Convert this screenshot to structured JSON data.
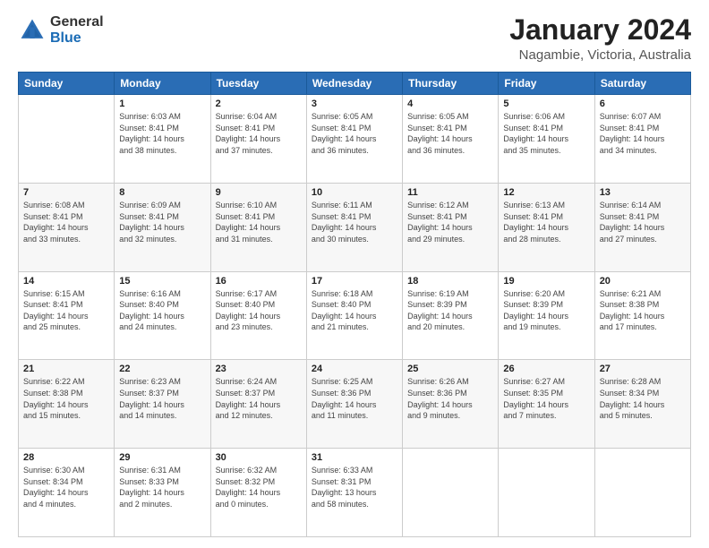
{
  "header": {
    "logo": {
      "general": "General",
      "blue": "Blue"
    },
    "title": "January 2024",
    "subtitle": "Nagambie, Victoria, Australia"
  },
  "calendar": {
    "days_of_week": [
      "Sunday",
      "Monday",
      "Tuesday",
      "Wednesday",
      "Thursday",
      "Friday",
      "Saturday"
    ],
    "weeks": [
      [
        {
          "day": "",
          "info": ""
        },
        {
          "day": "1",
          "info": "Sunrise: 6:03 AM\nSunset: 8:41 PM\nDaylight: 14 hours\nand 38 minutes."
        },
        {
          "day": "2",
          "info": "Sunrise: 6:04 AM\nSunset: 8:41 PM\nDaylight: 14 hours\nand 37 minutes."
        },
        {
          "day": "3",
          "info": "Sunrise: 6:05 AM\nSunset: 8:41 PM\nDaylight: 14 hours\nand 36 minutes."
        },
        {
          "day": "4",
          "info": "Sunrise: 6:05 AM\nSunset: 8:41 PM\nDaylight: 14 hours\nand 36 minutes."
        },
        {
          "day": "5",
          "info": "Sunrise: 6:06 AM\nSunset: 8:41 PM\nDaylight: 14 hours\nand 35 minutes."
        },
        {
          "day": "6",
          "info": "Sunrise: 6:07 AM\nSunset: 8:41 PM\nDaylight: 14 hours\nand 34 minutes."
        }
      ],
      [
        {
          "day": "7",
          "info": "Sunrise: 6:08 AM\nSunset: 8:41 PM\nDaylight: 14 hours\nand 33 minutes."
        },
        {
          "day": "8",
          "info": "Sunrise: 6:09 AM\nSunset: 8:41 PM\nDaylight: 14 hours\nand 32 minutes."
        },
        {
          "day": "9",
          "info": "Sunrise: 6:10 AM\nSunset: 8:41 PM\nDaylight: 14 hours\nand 31 minutes."
        },
        {
          "day": "10",
          "info": "Sunrise: 6:11 AM\nSunset: 8:41 PM\nDaylight: 14 hours\nand 30 minutes."
        },
        {
          "day": "11",
          "info": "Sunrise: 6:12 AM\nSunset: 8:41 PM\nDaylight: 14 hours\nand 29 minutes."
        },
        {
          "day": "12",
          "info": "Sunrise: 6:13 AM\nSunset: 8:41 PM\nDaylight: 14 hours\nand 28 minutes."
        },
        {
          "day": "13",
          "info": "Sunrise: 6:14 AM\nSunset: 8:41 PM\nDaylight: 14 hours\nand 27 minutes."
        }
      ],
      [
        {
          "day": "14",
          "info": "Sunrise: 6:15 AM\nSunset: 8:41 PM\nDaylight: 14 hours\nand 25 minutes."
        },
        {
          "day": "15",
          "info": "Sunrise: 6:16 AM\nSunset: 8:40 PM\nDaylight: 14 hours\nand 24 minutes."
        },
        {
          "day": "16",
          "info": "Sunrise: 6:17 AM\nSunset: 8:40 PM\nDaylight: 14 hours\nand 23 minutes."
        },
        {
          "day": "17",
          "info": "Sunrise: 6:18 AM\nSunset: 8:40 PM\nDaylight: 14 hours\nand 21 minutes."
        },
        {
          "day": "18",
          "info": "Sunrise: 6:19 AM\nSunset: 8:39 PM\nDaylight: 14 hours\nand 20 minutes."
        },
        {
          "day": "19",
          "info": "Sunrise: 6:20 AM\nSunset: 8:39 PM\nDaylight: 14 hours\nand 19 minutes."
        },
        {
          "day": "20",
          "info": "Sunrise: 6:21 AM\nSunset: 8:38 PM\nDaylight: 14 hours\nand 17 minutes."
        }
      ],
      [
        {
          "day": "21",
          "info": "Sunrise: 6:22 AM\nSunset: 8:38 PM\nDaylight: 14 hours\nand 15 minutes."
        },
        {
          "day": "22",
          "info": "Sunrise: 6:23 AM\nSunset: 8:37 PM\nDaylight: 14 hours\nand 14 minutes."
        },
        {
          "day": "23",
          "info": "Sunrise: 6:24 AM\nSunset: 8:37 PM\nDaylight: 14 hours\nand 12 minutes."
        },
        {
          "day": "24",
          "info": "Sunrise: 6:25 AM\nSunset: 8:36 PM\nDaylight: 14 hours\nand 11 minutes."
        },
        {
          "day": "25",
          "info": "Sunrise: 6:26 AM\nSunset: 8:36 PM\nDaylight: 14 hours\nand 9 minutes."
        },
        {
          "day": "26",
          "info": "Sunrise: 6:27 AM\nSunset: 8:35 PM\nDaylight: 14 hours\nand 7 minutes."
        },
        {
          "day": "27",
          "info": "Sunrise: 6:28 AM\nSunset: 8:34 PM\nDaylight: 14 hours\nand 5 minutes."
        }
      ],
      [
        {
          "day": "28",
          "info": "Sunrise: 6:30 AM\nSunset: 8:34 PM\nDaylight: 14 hours\nand 4 minutes."
        },
        {
          "day": "29",
          "info": "Sunrise: 6:31 AM\nSunset: 8:33 PM\nDaylight: 14 hours\nand 2 minutes."
        },
        {
          "day": "30",
          "info": "Sunrise: 6:32 AM\nSunset: 8:32 PM\nDaylight: 14 hours\nand 0 minutes."
        },
        {
          "day": "31",
          "info": "Sunrise: 6:33 AM\nSunset: 8:31 PM\nDaylight: 13 hours\nand 58 minutes."
        },
        {
          "day": "",
          "info": ""
        },
        {
          "day": "",
          "info": ""
        },
        {
          "day": "",
          "info": ""
        }
      ]
    ]
  }
}
